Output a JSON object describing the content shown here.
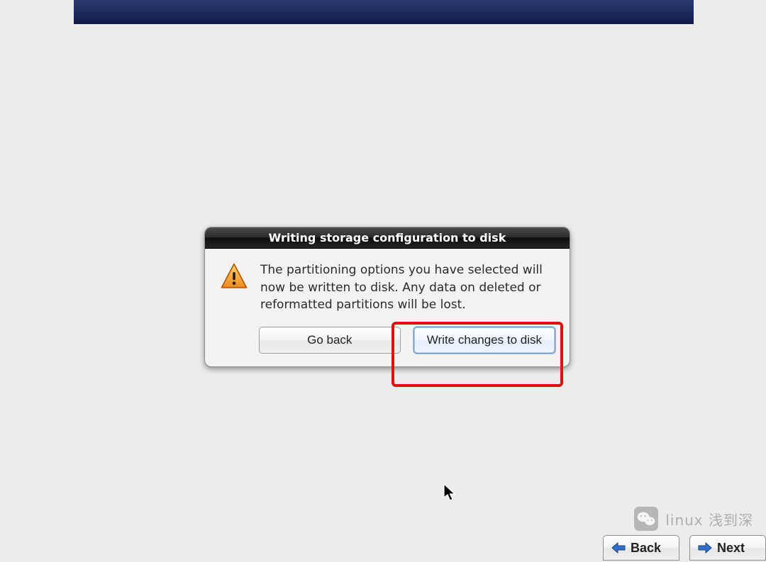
{
  "dialog": {
    "title": "Writing storage configuration to disk",
    "message": "The partitioning options you have selected will now be written to disk.  Any data on deleted or reformatted partitions will be lost.",
    "go_back_label": "Go back",
    "write_label": "Write changes to disk"
  },
  "nav": {
    "back_label": "Back",
    "next_label": "Next"
  },
  "watermark": {
    "text": "linux 浅到深"
  },
  "colors": {
    "highlight": "#e10f0f",
    "header_gradient_top": "#2b3c72",
    "header_gradient_bottom": "#0f1a46",
    "arrow_blue": "#2f6fd0"
  }
}
